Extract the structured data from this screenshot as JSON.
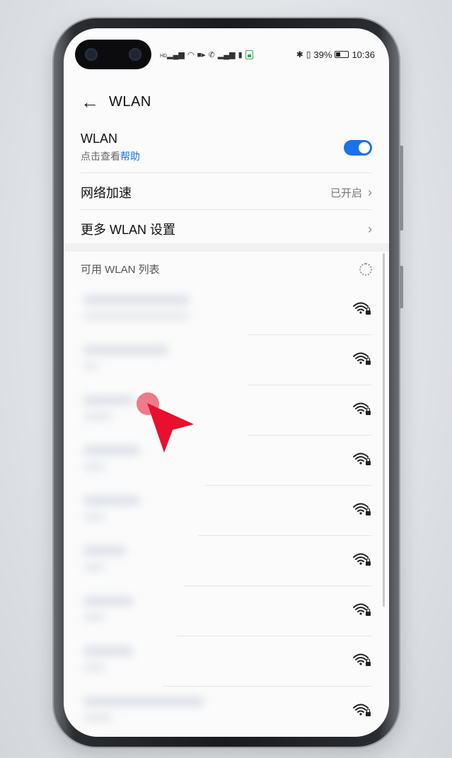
{
  "status_bar": {
    "left_icons": [
      "signal-icon",
      "wifi-icon",
      "video-icon",
      "phone-icon",
      "signal-icon-2",
      "battery-small-icon",
      "battery-green-icon"
    ],
    "hd_label": "HD",
    "battery_percent": "39%",
    "time": "10:36"
  },
  "header": {
    "title": "WLAN"
  },
  "wlan_toggle": {
    "label": "WLAN",
    "sub_prefix": "点击查看",
    "sub_link": "帮助",
    "enabled": true
  },
  "network_accel": {
    "label": "网络加速",
    "value": "已开启"
  },
  "more_settings": {
    "label": "更多 WLAN 设置"
  },
  "available_list": {
    "title": "可用 WLAN 列表",
    "networks": [
      {
        "secured": true,
        "icon": "wifi-lock-icon"
      },
      {
        "secured": true,
        "icon": "wifi-lock-icon"
      },
      {
        "secured": true,
        "icon": "wifi-lock-icon"
      },
      {
        "secured": true,
        "icon": "wifi-lock-icon"
      },
      {
        "secured": true,
        "icon": "wifi-lock-icon"
      },
      {
        "secured": true,
        "icon": "wifi-lock-icon"
      },
      {
        "secured": true,
        "icon": "wifi-lock-icon"
      },
      {
        "secured": true,
        "icon": "wifi-lock-icon"
      },
      {
        "secured": true,
        "icon": "wifi-lock-icon"
      }
    ]
  },
  "colors": {
    "accent": "#1a73e8",
    "cursor": "#e8102d"
  }
}
